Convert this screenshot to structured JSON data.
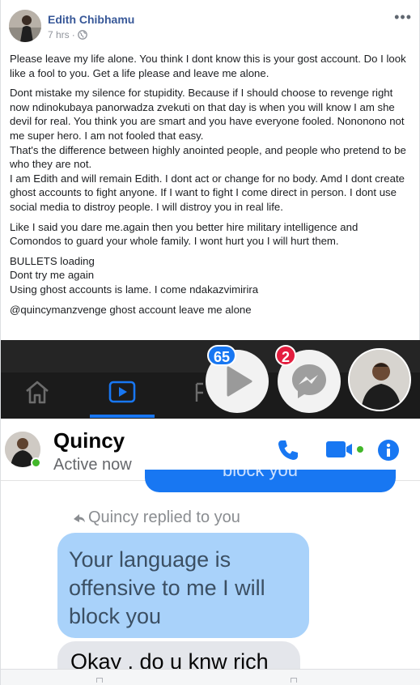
{
  "post": {
    "author": "Edith Chibhamu",
    "time": "7 hrs",
    "separator": "·",
    "audience_icon": "globe-icon",
    "more_icon": "more-options-icon",
    "paragraphs": [
      "Please leave my life alone. You think I dont know this is your gost account. Do I look like a fool to you. Get a life please and leave me alone.",
      "Dont mistake my silence for stupidity. Because if I should choose to revenge right now ndinokubaya panorwadza zvekuti on that day is when you will know I am she devil for real. You think you are smart and you have everyone fooled. Nononono not me super hero. I am not fooled that easy.",
      "That's the difference between highly anointed people, and people who pretend to be who they are not.",
      "I am Edith and will remain Edith. I dont act or change for no body. Amd I dont create ghost accounts to fight anyone. If I want to fight I come direct in person. I dont use social media to distroy people. I will distroy you in real life.",
      "Like I said you dare me.again then you better hire military intelligence and Comondos to guard your whole family. I wont hurt you I will hurt them.",
      "BULLETS loading",
      "Dont try me again",
      "Using ghost accounts is lame. I come ndakazvimirira"
    ],
    "mention": "@quincymanzvenge ghost account leave me alone"
  },
  "screenshot": {
    "badges": {
      "videos": "65",
      "messenger": "2"
    },
    "contact": {
      "name": "Quincy",
      "status": "Active now"
    },
    "prev_bubble_text": "block you",
    "reply_note": "Quincy replied to you",
    "quoted_message": "Your language is offensive to me I will block you",
    "next_message": "Okay , do u knw rich"
  },
  "colors": {
    "link": "#385898",
    "messenger_blue": "#1877f2",
    "quoted_bubble": "#a9d2fa",
    "online": "#42b72a",
    "badge_red": "#e41e3f"
  }
}
